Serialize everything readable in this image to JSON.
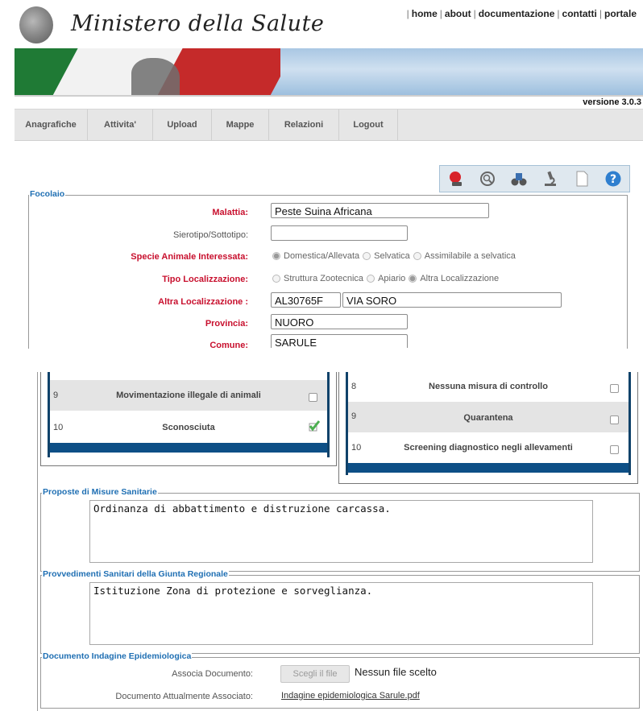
{
  "header": {
    "logo_text": "Ministero della Salute",
    "links": [
      "home",
      "about",
      "documentazione",
      "contatti",
      "portale"
    ],
    "version": "versione 3.0.3"
  },
  "menu": [
    "Anagrafiche",
    "Attivita'",
    "Upload",
    "Mappe",
    "Relazioni",
    "Logout"
  ],
  "toolbar_icons": [
    "red-ball-icon",
    "search-icon",
    "binoculars-icon",
    "microscope-icon",
    "document-icon",
    "help-icon"
  ],
  "focolaio": {
    "legend": "Focolaio",
    "malattia_label": "Malattia:",
    "malattia_value": "Peste Suina Africana",
    "sierotipo_label": "Sierotipo/Sottotipo:",
    "sierotipo_value": "",
    "specie_label": "Specie Animale Interessata:",
    "specie_options": [
      {
        "label": "Domestica/Allevata",
        "selected": true
      },
      {
        "label": "Selvatica",
        "selected": false
      },
      {
        "label": "Assimilabile a selvatica",
        "selected": false
      }
    ],
    "tipo_label": "Tipo Localizzazione:",
    "tipo_options": [
      {
        "label": "Struttura Zootecnica",
        "selected": false
      },
      {
        "label": "Apiario",
        "selected": false
      },
      {
        "label": "Altra Localizzazione",
        "selected": true
      }
    ],
    "altra_label": "Altra Localizzazione :",
    "altra_code": "AL30765F",
    "altra_address": "VIA SORO",
    "provincia_label": "Provincia:",
    "provincia_value": "NUORO",
    "comune_label": "Comune:",
    "comune_value": "SARULE"
  },
  "left_list": [
    {
      "num": "9",
      "label": "Movimentazione illegale di animali",
      "checked": false
    },
    {
      "num": "10",
      "label": "Sconosciuta",
      "checked": true
    }
  ],
  "right_list": [
    {
      "num": "8",
      "label": "Nessuna misura di controllo",
      "checked": false
    },
    {
      "num": "9",
      "label": "Quarantena",
      "checked": false
    },
    {
      "num": "10",
      "label": "Screening diagnostico negli allevamenti",
      "checked": false
    }
  ],
  "proposte": {
    "legend": "Proposte di Misure Sanitarie",
    "text": "Ordinanza di abbattimento e distruzione carcassa."
  },
  "provvedimenti": {
    "legend": "Provvedimenti Sanitari della Giunta Regionale",
    "text": "Istituzione Zona di protezione e sorveglianza."
  },
  "documento": {
    "legend": "Documento Indagine Epidemiologica",
    "associa_label": "Associa Documento:",
    "file_button": "Scegli il file",
    "file_status": "Nessun file scelto",
    "attuale_label": "Documento Attualmente Associato:",
    "attuale_link": "Indagine epidemiologica Sarule.pdf"
  },
  "colors": {
    "required": "#c8102e",
    "legend": "#1f6fb3",
    "list_bar": "#0d4f86",
    "check": "#4caf50"
  }
}
